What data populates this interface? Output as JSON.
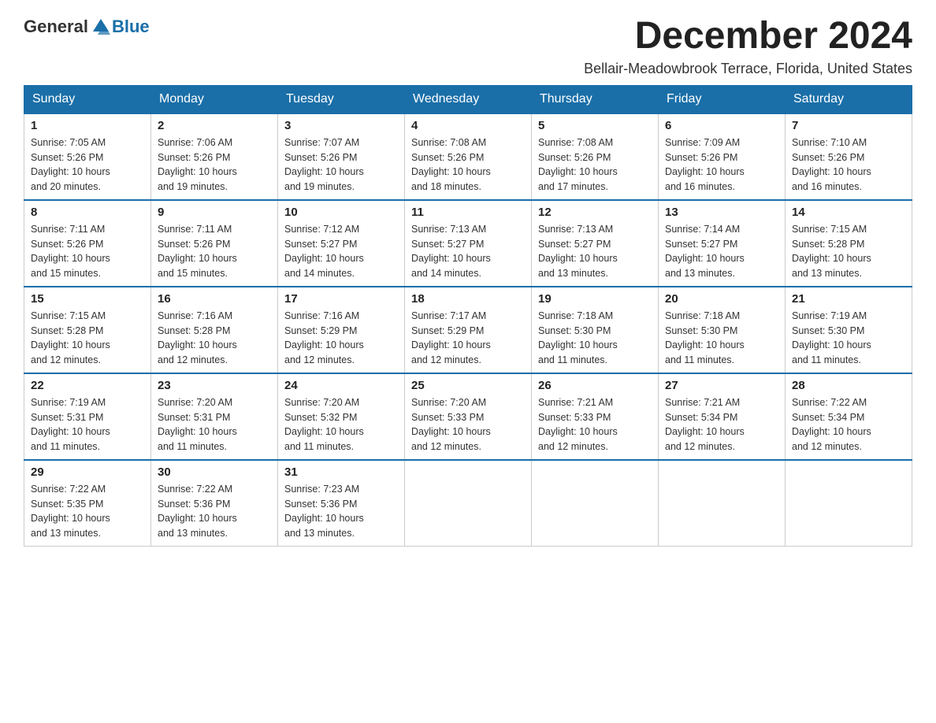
{
  "logo": {
    "general": "General",
    "blue": "Blue"
  },
  "title": "December 2024",
  "subtitle": "Bellair-Meadowbrook Terrace, Florida, United States",
  "days_of_week": [
    "Sunday",
    "Monday",
    "Tuesday",
    "Wednesday",
    "Thursday",
    "Friday",
    "Saturday"
  ],
  "weeks": [
    [
      {
        "day": "1",
        "sunrise": "7:05 AM",
        "sunset": "5:26 PM",
        "daylight": "10 hours and 20 minutes."
      },
      {
        "day": "2",
        "sunrise": "7:06 AM",
        "sunset": "5:26 PM",
        "daylight": "10 hours and 19 minutes."
      },
      {
        "day": "3",
        "sunrise": "7:07 AM",
        "sunset": "5:26 PM",
        "daylight": "10 hours and 19 minutes."
      },
      {
        "day": "4",
        "sunrise": "7:08 AM",
        "sunset": "5:26 PM",
        "daylight": "10 hours and 18 minutes."
      },
      {
        "day": "5",
        "sunrise": "7:08 AM",
        "sunset": "5:26 PM",
        "daylight": "10 hours and 17 minutes."
      },
      {
        "day": "6",
        "sunrise": "7:09 AM",
        "sunset": "5:26 PM",
        "daylight": "10 hours and 16 minutes."
      },
      {
        "day": "7",
        "sunrise": "7:10 AM",
        "sunset": "5:26 PM",
        "daylight": "10 hours and 16 minutes."
      }
    ],
    [
      {
        "day": "8",
        "sunrise": "7:11 AM",
        "sunset": "5:26 PM",
        "daylight": "10 hours and 15 minutes."
      },
      {
        "day": "9",
        "sunrise": "7:11 AM",
        "sunset": "5:26 PM",
        "daylight": "10 hours and 15 minutes."
      },
      {
        "day": "10",
        "sunrise": "7:12 AM",
        "sunset": "5:27 PM",
        "daylight": "10 hours and 14 minutes."
      },
      {
        "day": "11",
        "sunrise": "7:13 AM",
        "sunset": "5:27 PM",
        "daylight": "10 hours and 14 minutes."
      },
      {
        "day": "12",
        "sunrise": "7:13 AM",
        "sunset": "5:27 PM",
        "daylight": "10 hours and 13 minutes."
      },
      {
        "day": "13",
        "sunrise": "7:14 AM",
        "sunset": "5:27 PM",
        "daylight": "10 hours and 13 minutes."
      },
      {
        "day": "14",
        "sunrise": "7:15 AM",
        "sunset": "5:28 PM",
        "daylight": "10 hours and 13 minutes."
      }
    ],
    [
      {
        "day": "15",
        "sunrise": "7:15 AM",
        "sunset": "5:28 PM",
        "daylight": "10 hours and 12 minutes."
      },
      {
        "day": "16",
        "sunrise": "7:16 AM",
        "sunset": "5:28 PM",
        "daylight": "10 hours and 12 minutes."
      },
      {
        "day": "17",
        "sunrise": "7:16 AM",
        "sunset": "5:29 PM",
        "daylight": "10 hours and 12 minutes."
      },
      {
        "day": "18",
        "sunrise": "7:17 AM",
        "sunset": "5:29 PM",
        "daylight": "10 hours and 12 minutes."
      },
      {
        "day": "19",
        "sunrise": "7:18 AM",
        "sunset": "5:30 PM",
        "daylight": "10 hours and 11 minutes."
      },
      {
        "day": "20",
        "sunrise": "7:18 AM",
        "sunset": "5:30 PM",
        "daylight": "10 hours and 11 minutes."
      },
      {
        "day": "21",
        "sunrise": "7:19 AM",
        "sunset": "5:30 PM",
        "daylight": "10 hours and 11 minutes."
      }
    ],
    [
      {
        "day": "22",
        "sunrise": "7:19 AM",
        "sunset": "5:31 PM",
        "daylight": "10 hours and 11 minutes."
      },
      {
        "day": "23",
        "sunrise": "7:20 AM",
        "sunset": "5:31 PM",
        "daylight": "10 hours and 11 minutes."
      },
      {
        "day": "24",
        "sunrise": "7:20 AM",
        "sunset": "5:32 PM",
        "daylight": "10 hours and 11 minutes."
      },
      {
        "day": "25",
        "sunrise": "7:20 AM",
        "sunset": "5:33 PM",
        "daylight": "10 hours and 12 minutes."
      },
      {
        "day": "26",
        "sunrise": "7:21 AM",
        "sunset": "5:33 PM",
        "daylight": "10 hours and 12 minutes."
      },
      {
        "day": "27",
        "sunrise": "7:21 AM",
        "sunset": "5:34 PM",
        "daylight": "10 hours and 12 minutes."
      },
      {
        "day": "28",
        "sunrise": "7:22 AM",
        "sunset": "5:34 PM",
        "daylight": "10 hours and 12 minutes."
      }
    ],
    [
      {
        "day": "29",
        "sunrise": "7:22 AM",
        "sunset": "5:35 PM",
        "daylight": "10 hours and 13 minutes."
      },
      {
        "day": "30",
        "sunrise": "7:22 AM",
        "sunset": "5:36 PM",
        "daylight": "10 hours and 13 minutes."
      },
      {
        "day": "31",
        "sunrise": "7:23 AM",
        "sunset": "5:36 PM",
        "daylight": "10 hours and 13 minutes."
      },
      null,
      null,
      null,
      null
    ]
  ],
  "labels": {
    "sunrise": "Sunrise:",
    "sunset": "Sunset:",
    "daylight": "Daylight:"
  }
}
